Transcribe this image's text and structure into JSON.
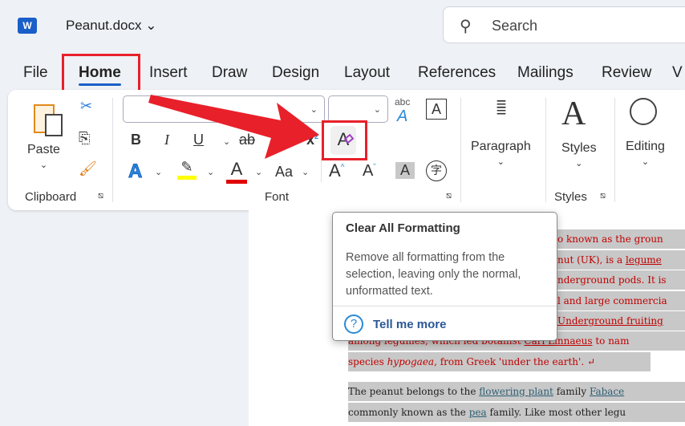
{
  "title": {
    "doc_name": "Peanut.docx",
    "search_placeholder": "Search"
  },
  "tabs": [
    "File",
    "Home",
    "Insert",
    "Draw",
    "Design",
    "Layout",
    "References",
    "Mailings",
    "Review",
    "V"
  ],
  "ribbon": {
    "clipboard": {
      "paste": "Paste",
      "group": "Clipboard"
    },
    "font": {
      "bold": "B",
      "italic": "I",
      "underline": "U",
      "strike": "ab",
      "subscript": "x",
      "superscript": "x",
      "text_effects": "A",
      "font_color": "A",
      "change_case": "Aa",
      "grow": "A",
      "shrink": "A",
      "shading": "A",
      "phonetic": "字",
      "clear": "A",
      "group": "Font",
      "highlight_color": "#ffff00",
      "font_color_value": "#e00000"
    },
    "paragraph": {
      "label": "Paragraph"
    },
    "styles": {
      "label": "Styles",
      "group": "Styles"
    },
    "editing": {
      "label": "Editing"
    }
  },
  "tooltip": {
    "title": "Clear All Formatting",
    "body": "Remove all formatting from the selection, leaving only the normal, unformatted text.",
    "link": "Tell me more"
  },
  "document": {
    "l1": "o known as the groun",
    "l2a": "nut (UK), is a ",
    "l2b": "legume",
    "l3": "nderground pods. It is",
    "l4": "l and large commercia",
    "l5": "Underground fruiting",
    "l6a": "among legumes, which led botanist ",
    "l6b": "Carl Linnaeus",
    "l6c": " to nam",
    "l7a": "species ",
    "l7b": "hypogaea",
    "l7c": ", from Greek 'under the earth'. ↵",
    "l8a": "The peanut belongs to the ",
    "l8b": "flowering plant",
    "l8c": " family ",
    "l8d": "Fabace",
    "l9a": "commonly known as the ",
    "l9b": "pea",
    "l9c": " family. Like most other legu"
  }
}
